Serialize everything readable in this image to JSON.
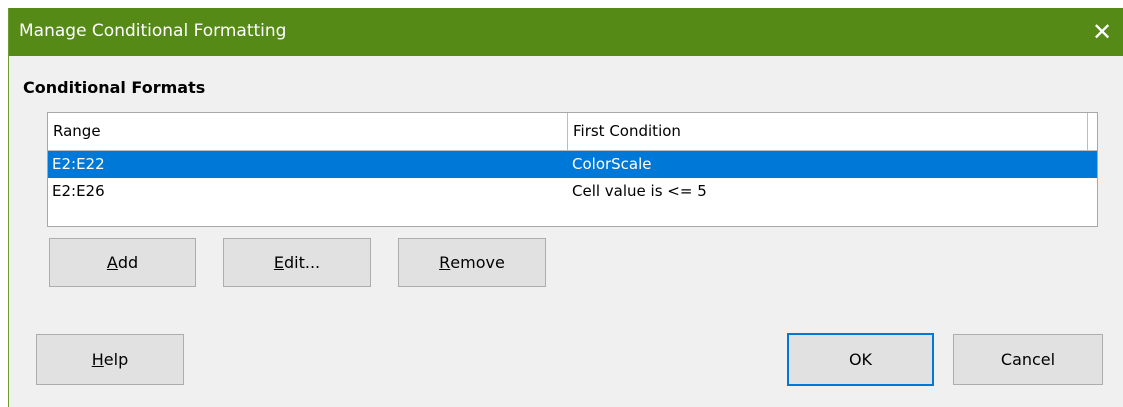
{
  "dialog": {
    "title": "Manage Conditional Formatting",
    "close_glyph": "✕",
    "section_label": "Conditional Formats"
  },
  "list": {
    "columns": [
      "Range",
      "First Condition"
    ],
    "rows": [
      {
        "range": "E2:E22",
        "condition": "ColorScale",
        "selected": true
      },
      {
        "range": "E2:E26",
        "condition": "Cell value is <= 5",
        "selected": false
      }
    ]
  },
  "buttons": {
    "add": {
      "mnemonic": "A",
      "rest": "dd"
    },
    "edit": {
      "mnemonic": "E",
      "rest": "dit..."
    },
    "remove": {
      "mnemonic": "R",
      "rest": "emove"
    },
    "help": {
      "mnemonic": "H",
      "rest": "elp"
    },
    "ok": "OK",
    "cancel": "Cancel"
  },
  "colors": {
    "titlebar": "#558a17",
    "selection": "#0078d7",
    "dialog_bg": "#f0f0f0"
  }
}
